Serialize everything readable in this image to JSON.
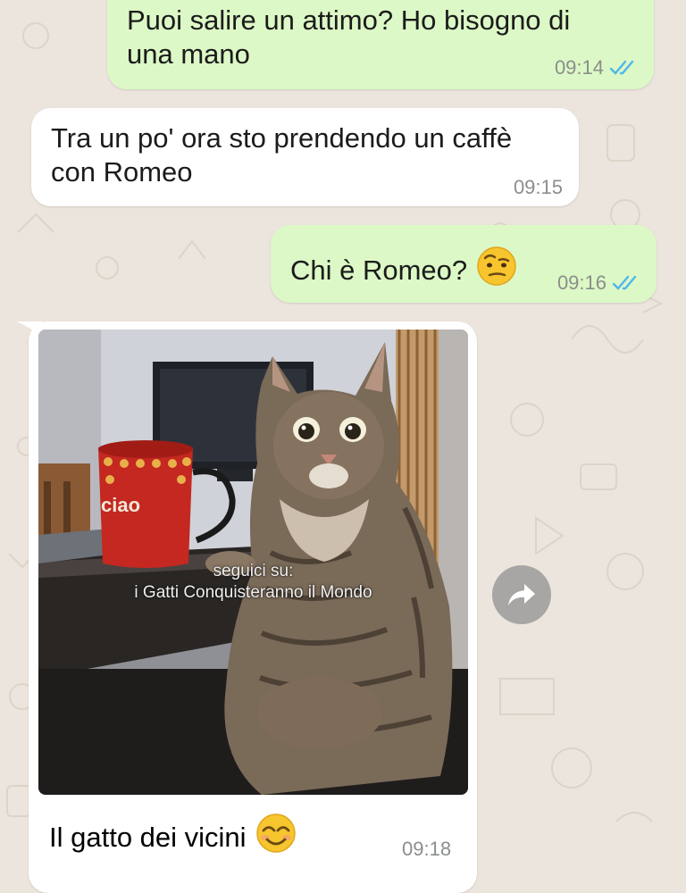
{
  "messages": [
    {
      "direction": "outgoing",
      "text_line1": "Puoi salire un attimo? Ho bisogno di",
      "text_line2": "una mano",
      "time": "09:14",
      "status": "read"
    },
    {
      "direction": "incoming",
      "text_line1": "Tra un po' ora sto prendendo un caffè",
      "text_line2": "con Romeo",
      "time": "09:15"
    },
    {
      "direction": "outgoing",
      "text": "Chi è Romeo?",
      "emoji": "face-with-raised-eyebrow",
      "time": "09:16",
      "status": "read"
    },
    {
      "direction": "incoming",
      "type": "image",
      "image_description_icon": "cat-photo",
      "overlay_line1": "seguici su:",
      "overlay_line2": "i Gatti Conquisteranno il Mondo",
      "mug_text": "ciao",
      "caption": "Il gatto dei vicini",
      "caption_emoji": "smiling-face-with-smiling-eyes",
      "time": "09:18"
    }
  ],
  "colors": {
    "chat_background": "#ece5dd",
    "outgoing_bubble": "#dcf8c6",
    "incoming_bubble": "#ffffff",
    "read_ticks": "#4fb6ec",
    "timestamp": "#8a8f8a"
  },
  "icons": {
    "forward": "forward-arrow-icon",
    "read_receipt": "double-check-icon"
  }
}
